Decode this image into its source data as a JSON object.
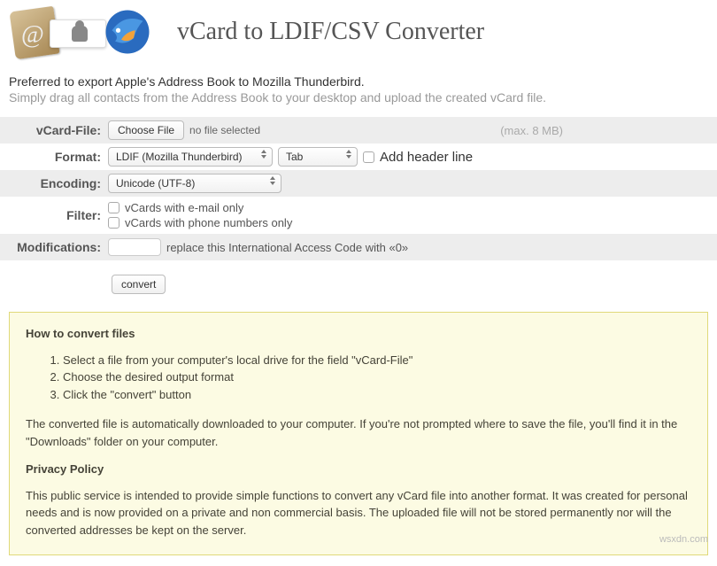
{
  "title": "vCard to LDIF/CSV Converter",
  "intro": {
    "line1": "Preferred to export Apple's Address Book to Mozilla Thunderbird.",
    "line2": "Simply drag all contacts from the Address Book to your desktop and upload the created vCard file."
  },
  "form": {
    "vcard_label": "vCard-File:",
    "choose_file_btn": "Choose File",
    "no_file_text": "no file selected",
    "max_size": "(max. 8 MB)",
    "format_label": "Format:",
    "format_value": "LDIF (Mozilla Thunderbird)",
    "delimiter_value": "Tab",
    "add_header_label": "Add header line",
    "encoding_label": "Encoding:",
    "encoding_value": "Unicode (UTF-8)",
    "filter_label": "Filter:",
    "filter_email": "vCards with e-mail only",
    "filter_phone": "vCards with phone numbers only",
    "modifications_label": "Modifications:",
    "modifications_text": "replace this International Access Code with «0»",
    "convert_btn": "convert"
  },
  "info": {
    "how_heading": "How to convert files",
    "step1": "Select a file from your computer's local drive for the field \"vCard-File\"",
    "step2": "Choose the desired output format",
    "step3": "Click the \"convert\" button",
    "auto_dl": "The converted file is automatically downloaded to your computer. If you're not prompted where to save the file, you'll find it in the \"Downloads\" folder on your computer.",
    "privacy_heading": "Privacy Policy",
    "privacy_text": "This public service is intended to provide simple functions to convert any vCard file into another format. It was created for personal needs and is now provided on a private and non commercial basis. The uploaded file will not be stored permanently nor will the converted addresses be kept on the server."
  },
  "watermark": "wsxdn.com"
}
